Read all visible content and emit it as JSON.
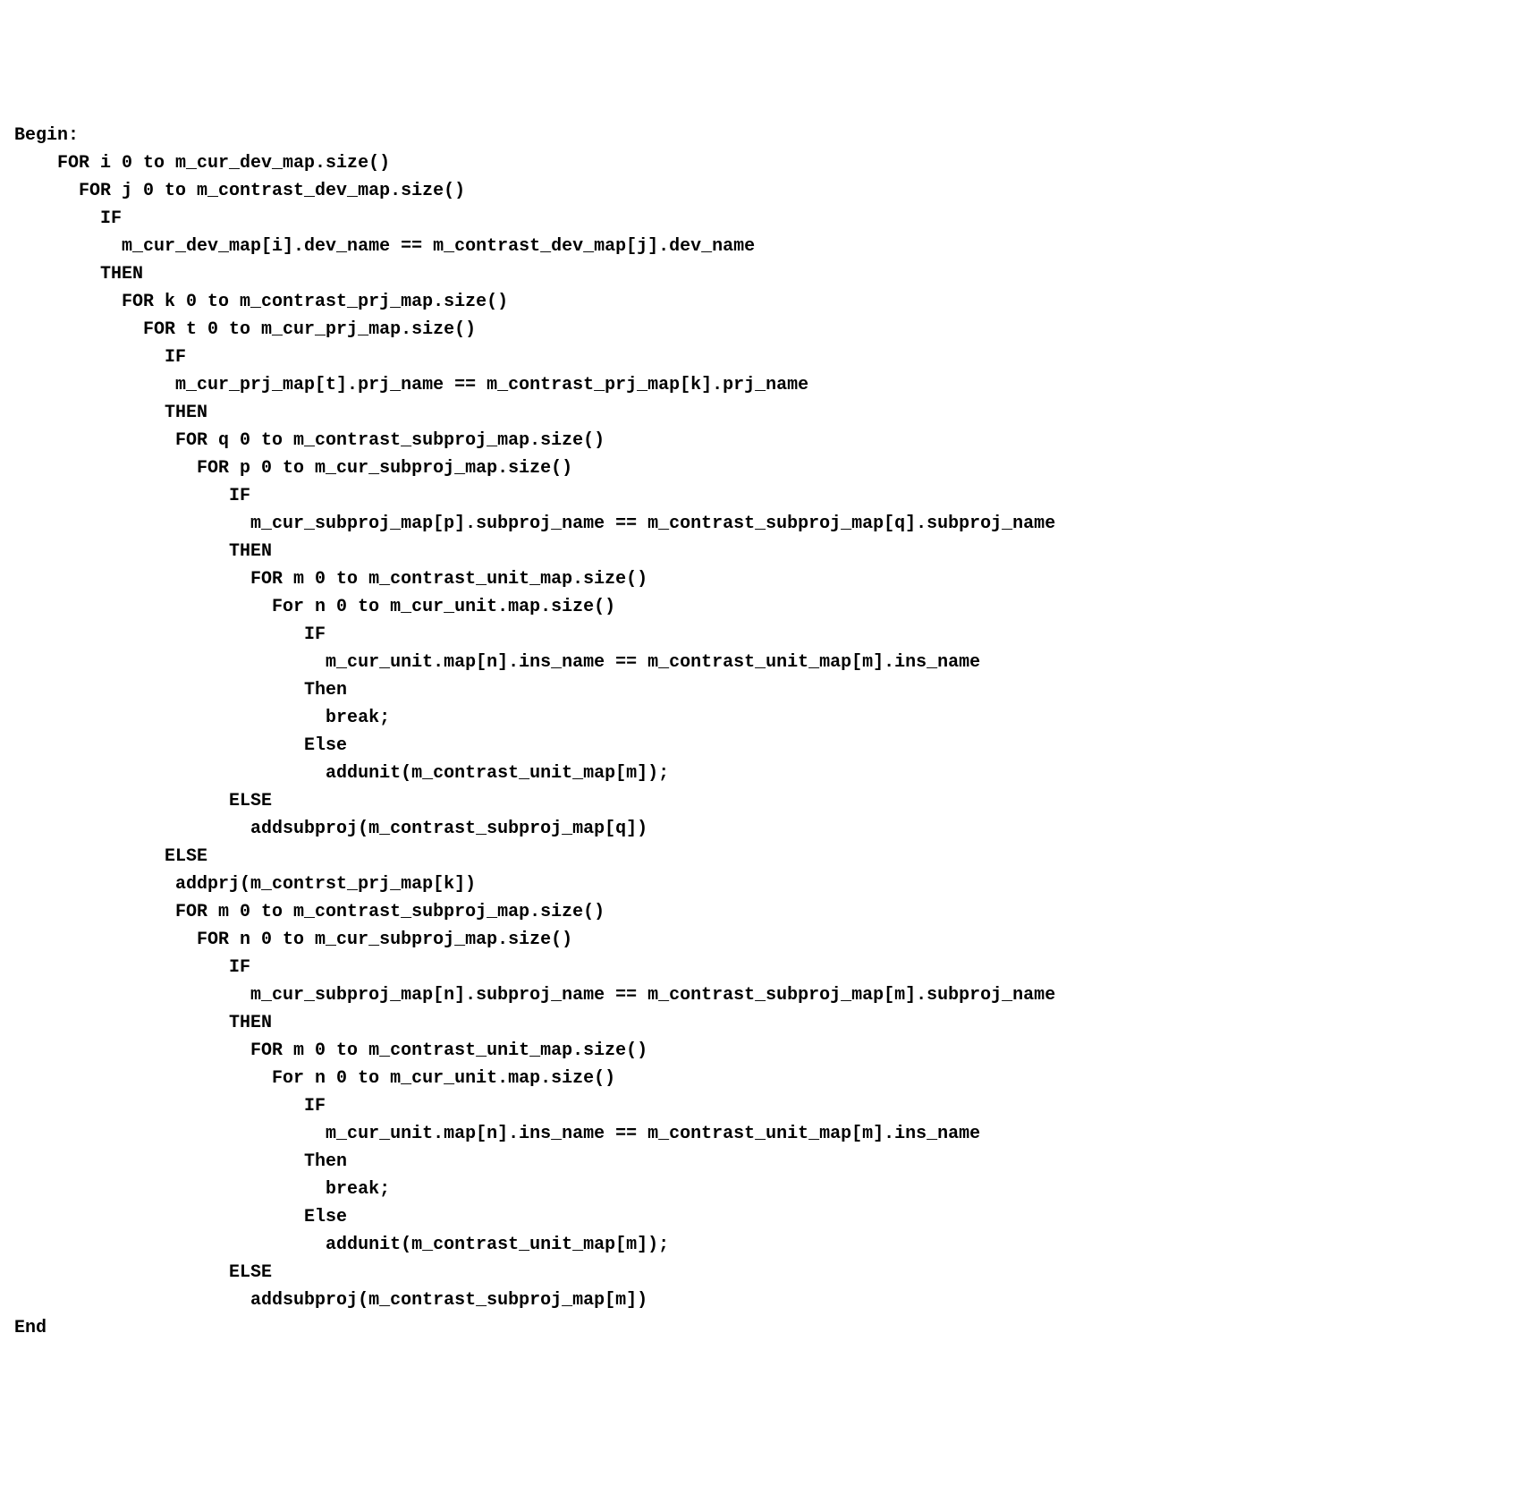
{
  "code": {
    "lines": [
      "Begin:",
      "    FOR i 0 to m_cur_dev_map.size()",
      "      FOR j 0 to m_contrast_dev_map.size()",
      "        IF",
      "          m_cur_dev_map[i].dev_name == m_contrast_dev_map[j].dev_name",
      "        THEN",
      "          FOR k 0 to m_contrast_prj_map.size()",
      "            FOR t 0 to m_cur_prj_map.size()",
      "              IF",
      "               m_cur_prj_map[t].prj_name == m_contrast_prj_map[k].prj_name",
      "              THEN",
      "               FOR q 0 to m_contrast_subproj_map.size()",
      "                 FOR p 0 to m_cur_subproj_map.size()",
      "                    IF",
      "                      m_cur_subproj_map[p].subproj_name == m_contrast_subproj_map[q].subproj_name",
      "                    THEN",
      "                      FOR m 0 to m_contrast_unit_map.size()",
      "                        For n 0 to m_cur_unit.map.size()",
      "                           IF",
      "                             m_cur_unit.map[n].ins_name == m_contrast_unit_map[m].ins_name",
      "                           Then",
      "                             break;",
      "                           Else",
      "                             addunit(m_contrast_unit_map[m]);",
      "                    ELSE",
      "                      addsubproj(m_contrast_subproj_map[q])",
      "              ELSE",
      "               addprj(m_contrst_prj_map[k])",
      "               FOR m 0 to m_contrast_subproj_map.size()",
      "                 FOR n 0 to m_cur_subproj_map.size()",
      "                    IF",
      "                      m_cur_subproj_map[n].subproj_name == m_contrast_subproj_map[m].subproj_name",
      "                    THEN",
      "                      FOR m 0 to m_contrast_unit_map.size()",
      "                        For n 0 to m_cur_unit.map.size()",
      "                           IF",
      "                             m_cur_unit.map[n].ins_name == m_contrast_unit_map[m].ins_name",
      "                           Then",
      "                             break;",
      "                           Else",
      "                             addunit(m_contrast_unit_map[m]);",
      "                    ELSE",
      "                      addsubproj(m_contrast_subproj_map[m])",
      "End"
    ]
  }
}
